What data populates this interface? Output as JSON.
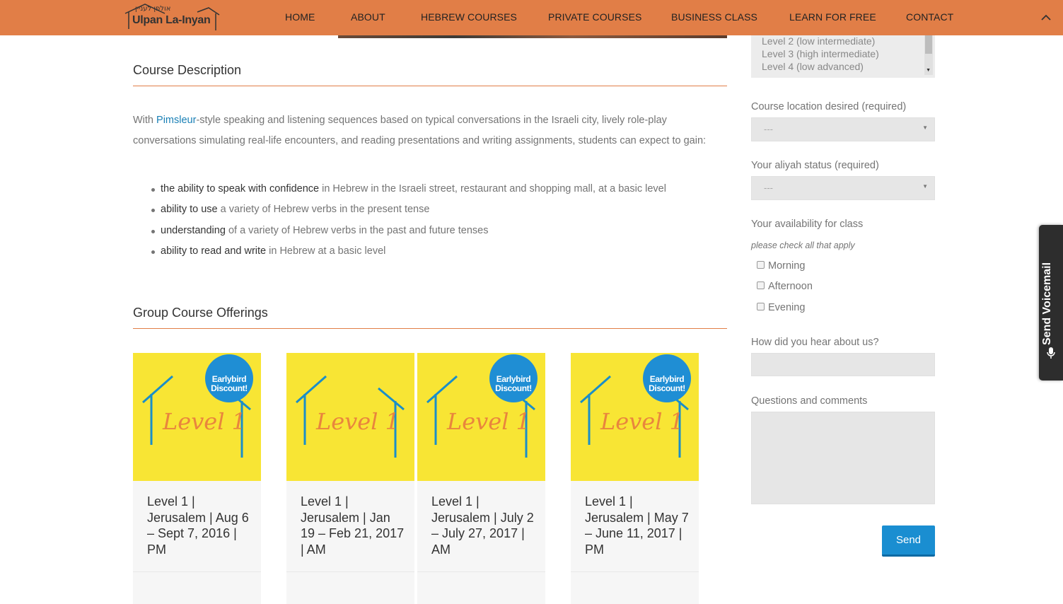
{
  "header": {
    "logo_hebrew": "אולפן לעניין",
    "logo_text": "Ulpan La-Inyan",
    "nav": [
      "HOME",
      "ABOUT",
      "HEBREW COURSES",
      "PRIVATE COURSES",
      "BUSINESS CLASS",
      "LEARN FOR FREE",
      "CONTACT"
    ],
    "accent_color": "#e17e47"
  },
  "course_description": {
    "title": "Course Description",
    "intro_before_link": "With ",
    "link_text": "Pimsleur",
    "intro_after_link": "-style speaking and listening sequences based on typical conversations in the Israeli city, lively role-play conversations simulating real-life encounters, and reading presentations and writing assignments, students can expect to gain:",
    "bullets": [
      {
        "bold": "the ability to speak with confidence",
        "rest": " in Hebrew in the Israeli street, restaurant and shopping mall, at a basic level"
      },
      {
        "bold": "ability to use",
        "rest": " a variety of Hebrew verbs in the present tense"
      },
      {
        "bold": "understanding",
        "rest": " of a variety of Hebrew verbs in the past and future tenses"
      },
      {
        "bold": "ability to read and write",
        "rest": " in Hebrew at a basic level"
      }
    ]
  },
  "group_offerings": {
    "title": "Group Course Offerings",
    "cards": [
      {
        "title": "Level 1 | Jerusalem | Aug 6 – Sept 7, 2016 | PM",
        "badge": "Earlybird Discount!",
        "image_text": "Level 1"
      },
      {
        "title": "Level 1 | Jerusalem | Jan 19 – Feb 21, 2017 | AM",
        "badge": "",
        "image_text": "Level 1"
      },
      {
        "title": "Level 1 | Jerusalem | July 2 – July 27, 2017 | AM",
        "badge": "Earlybird Discount!",
        "image_text": "Level 1"
      },
      {
        "title": "Level 1 | Jerusalem | May 7 – June 11, 2017 | PM",
        "badge": "Earlybird Discount!",
        "image_text": "Level 1"
      }
    ]
  },
  "form": {
    "level_options": [
      "Level 2 (low intermediate)",
      "Level 3 (high intermediate)",
      "Level 4 (low advanced)"
    ],
    "location_label": "Course location desired (required)",
    "location_value": "---",
    "aliyah_label": "Your aliyah status (required)",
    "aliyah_value": "---",
    "availability_label": "Your availability for class",
    "availability_hint": "please check all that apply",
    "availability_options": [
      "Morning",
      "Afternoon",
      "Evening"
    ],
    "hear_label": "How did you hear about us?",
    "hear_value": "",
    "questions_label": "Questions and comments",
    "questions_value": "",
    "send_label": "Send"
  },
  "voicemail": {
    "label": "Send Voicemail"
  }
}
